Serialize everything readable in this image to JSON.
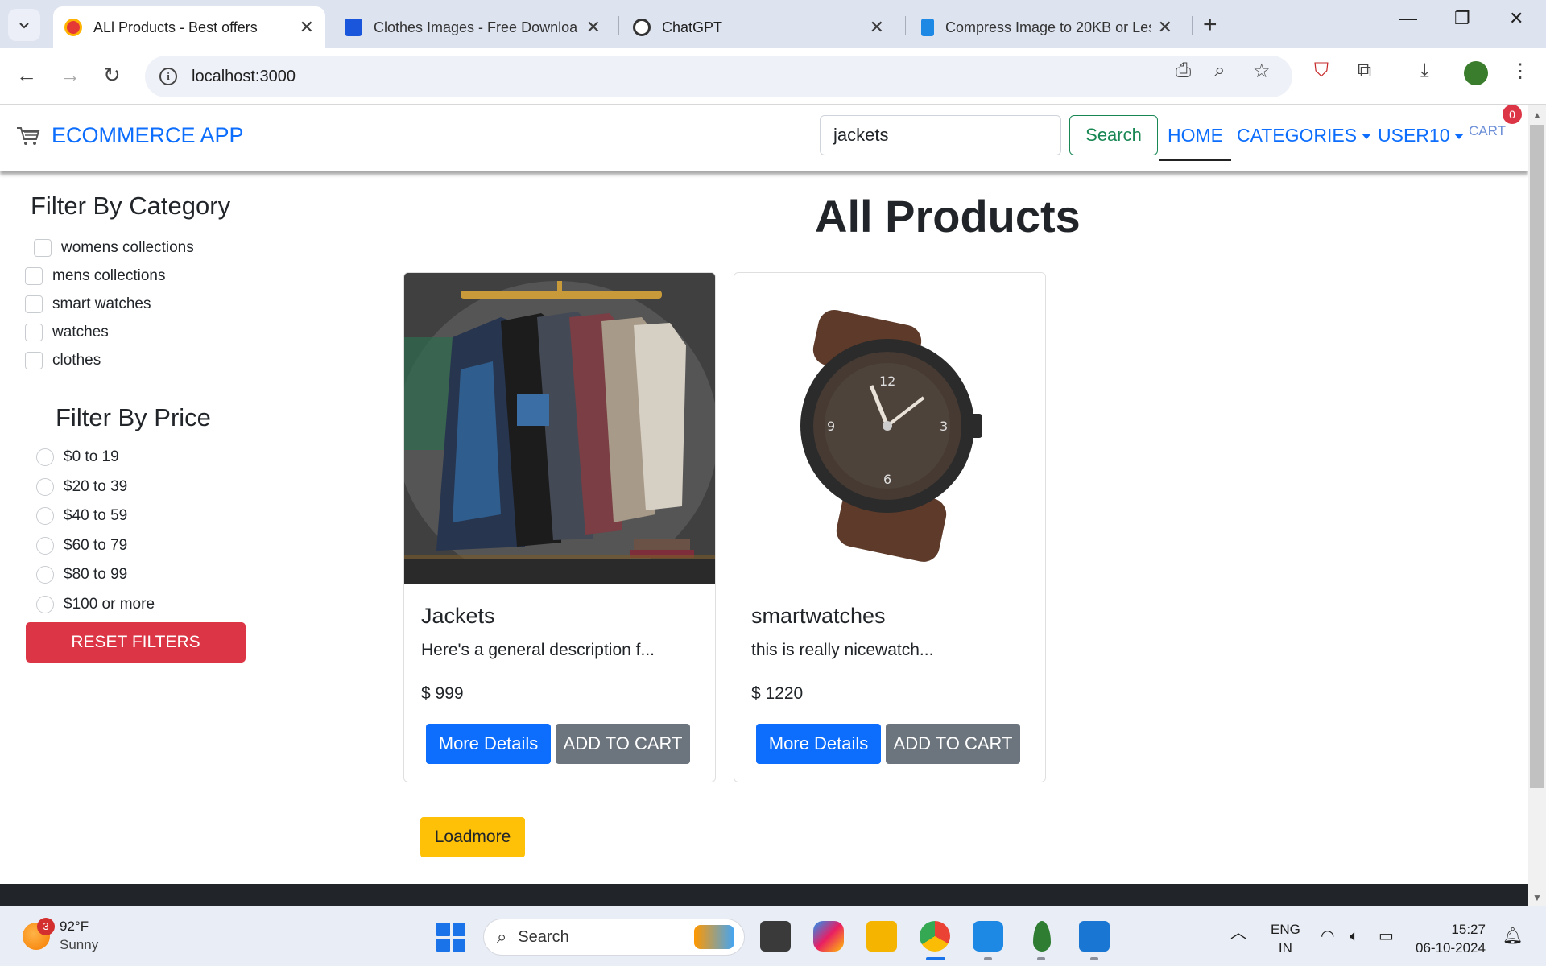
{
  "browser": {
    "tabs": [
      {
        "title": "ALl Products - Best offers",
        "active": true
      },
      {
        "title": "Clothes Images - Free Downloa",
        "active": false
      },
      {
        "title": "ChatGPT",
        "active": false
      },
      {
        "title": "Compress Image to 20KB or Les",
        "active": false
      }
    ],
    "url": "localhost:3000"
  },
  "navbar": {
    "brand": "ECOMMERCE APP",
    "search_value": "jackets",
    "search_button": "Search",
    "links": {
      "home": "HOME",
      "categories": "CATEGORIES",
      "user": "USER10",
      "cart": "CART"
    },
    "cart_count": "0"
  },
  "filters": {
    "category_title": "Filter By Category",
    "categories": [
      "womens collections",
      "mens collections",
      "smart watches",
      "watches",
      "clothes"
    ],
    "price_title": "Filter By Price",
    "prices": [
      "$0 to 19",
      "$20 to 39",
      "$40 to 59",
      "$60 to 79",
      "$80 to 99",
      "$100 or more"
    ],
    "reset": "RESET FILTERS"
  },
  "main": {
    "title": "All Products",
    "products": [
      {
        "name": "Jackets",
        "description": "Here's a general description f...",
        "price": "$ 999",
        "details_button": "More Details",
        "cart_button": "ADD TO CART"
      },
      {
        "name": "smartwatches",
        "description": "this is really nicewatch...",
        "price": "$ 1220",
        "details_button": "More Details",
        "cart_button": "ADD TO CART"
      }
    ],
    "loadmore": "Loadmore"
  },
  "taskbar": {
    "weather_temp": "92°F",
    "weather_desc": "Sunny",
    "weather_badge": "3",
    "search_placeholder": "Search",
    "lang_primary": "ENG",
    "lang_secondary": "IN",
    "time": "15:27",
    "date": "06-10-2024"
  },
  "colors": {
    "primary": "#0d6efd",
    "danger": "#dc3545",
    "secondary": "#6c757d",
    "warning": "#ffc107",
    "success": "#198754"
  }
}
